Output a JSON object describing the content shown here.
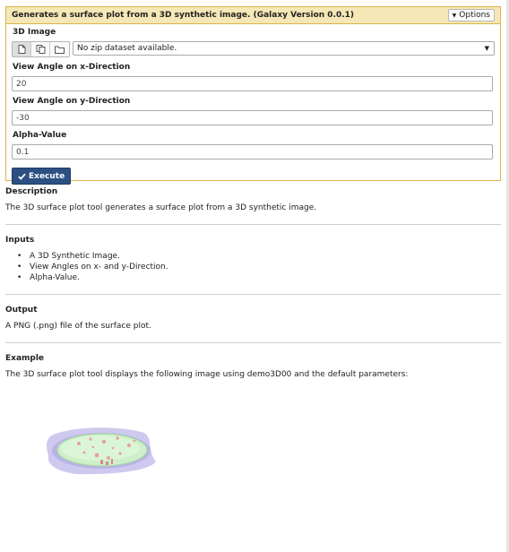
{
  "tool": {
    "title": "Generates a surface plot from a 3D synthetic image. (Galaxy Version 0.0.1)",
    "options_label": "Options",
    "options_icon": "caret-down-icon"
  },
  "form": {
    "image_label": "3D Image",
    "dataset_buttons": [
      {
        "icon": "single-dataset-icon",
        "active": true
      },
      {
        "icon": "multiple-datasets-icon",
        "active": false
      },
      {
        "icon": "folder-icon",
        "active": false
      }
    ],
    "dataset_value": "No zip dataset available.",
    "angle_x_label": "View Angle on x-Direction",
    "angle_x_value": "20",
    "angle_y_label": "View Angle on y-Direction",
    "angle_y_value": "-30",
    "alpha_label": "Alpha-Value",
    "alpha_value": "0.1",
    "execute_label": "Execute"
  },
  "help": {
    "description_heading": "Description",
    "description_text": "The 3D surface plot tool generates a surface plot from a 3D synthetic image.",
    "inputs_heading": "Inputs",
    "inputs_items": [
      "A 3D Synthetic Image.",
      "View Angles on x- and y-Direction.",
      "Alpha-Value."
    ],
    "output_heading": "Output",
    "output_text": "A PNG (.png) file of the surface plot.",
    "example_heading": "Example",
    "example_text": "The 3D surface plot tool displays the following image using demo3D00 and the default parameters:"
  },
  "colors": {
    "panel_border": "#d9b54a",
    "panel_header": "#f6e7b6",
    "execute_button": "#2c5082"
  }
}
